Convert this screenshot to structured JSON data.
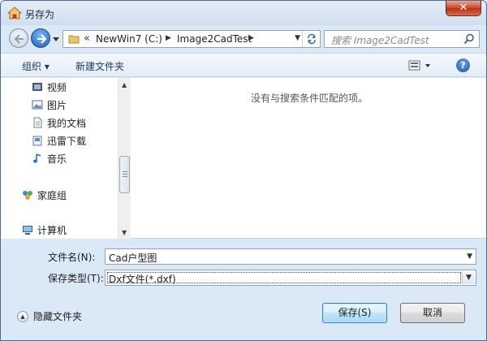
{
  "window": {
    "title": "另存为",
    "close_label": "✕"
  },
  "nav": {
    "address": {
      "prefix": "«",
      "crumbs": [
        "NewWin7 (C:)",
        "Image2CadTest"
      ]
    },
    "search_placeholder": "搜索 Image2CadTest"
  },
  "toolbar": {
    "organize": "组织 ▾",
    "new_folder": "新建文件夹",
    "help": "?"
  },
  "nav_pane": {
    "items": [
      {
        "label": "视频",
        "icon": "video-library-icon"
      },
      {
        "label": "图片",
        "icon": "pictures-library-icon"
      },
      {
        "label": "我的文档",
        "icon": "documents-library-icon"
      },
      {
        "label": "迅雷下载",
        "icon": "download-folder-icon"
      },
      {
        "label": "音乐",
        "icon": "music-library-icon"
      },
      {
        "label": "家庭组",
        "icon": "homegroup-icon"
      },
      {
        "label": "计算机",
        "icon": "computer-icon"
      }
    ]
  },
  "content": {
    "empty_message": "没有与搜索条件匹配的项。"
  },
  "form": {
    "filename_label": "文件名(N):",
    "filename_value": "Cad户型图",
    "filetype_label": "保存类型(T):",
    "filetype_value": "Dxf文件(*.dxf)"
  },
  "footer": {
    "hide_folders": "隐藏文件夹",
    "save": "保存(S)",
    "cancel": "取消"
  }
}
